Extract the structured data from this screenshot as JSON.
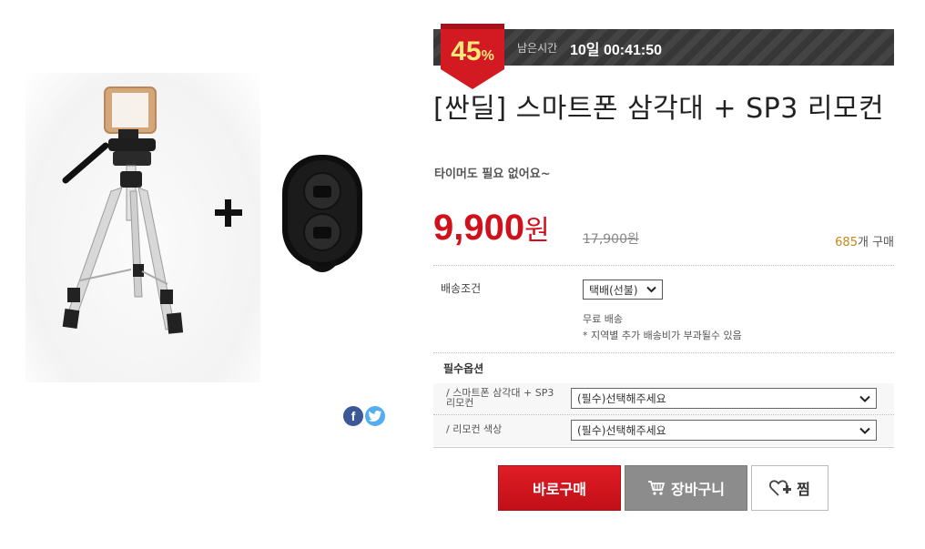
{
  "countdown": {
    "label": "남은시간",
    "value": "10일 00:41:50"
  },
  "discount": {
    "percent": "45",
    "unit": "%"
  },
  "product": {
    "title": "[싼딜] 스마트폰 삼각대 + SP3 리모컨",
    "subtitle": "타이머도 필요 없어요~",
    "plus_sign": "+"
  },
  "price": {
    "value": "9,900",
    "unit": "원",
    "original": "17,900원"
  },
  "sales": {
    "count": "685",
    "suffix": "개 구매"
  },
  "shipping": {
    "label": "배송조건",
    "selected": "택배(선불)",
    "free_text": "무료 배송",
    "note": "* 지역별 추가 배송비가 부과될수 있음"
  },
  "options": {
    "header": "필수옵션",
    "rows": [
      {
        "label_line1": "/ 스마트폰 삼각대 + SP3",
        "label_line2": "리모컨",
        "placeholder": "(필수)선택해주세요"
      },
      {
        "label_line1": "/ 리모컨 색상",
        "label_line2": "",
        "placeholder": "(필수)선택해주세요"
      }
    ]
  },
  "actions": {
    "buy": "바로구매",
    "cart": "장바구니",
    "wish": "찜"
  },
  "share": {
    "facebook": "f",
    "twitter": "t"
  },
  "colors": {
    "accent_red": "#d0111b",
    "sold_orange": "#c8861a",
    "timer_bg": "#3a3a3a"
  },
  "icons": [
    "facebook-icon",
    "twitter-icon",
    "chevron-down-icon",
    "cart-icon",
    "heart-plus-icon"
  ]
}
